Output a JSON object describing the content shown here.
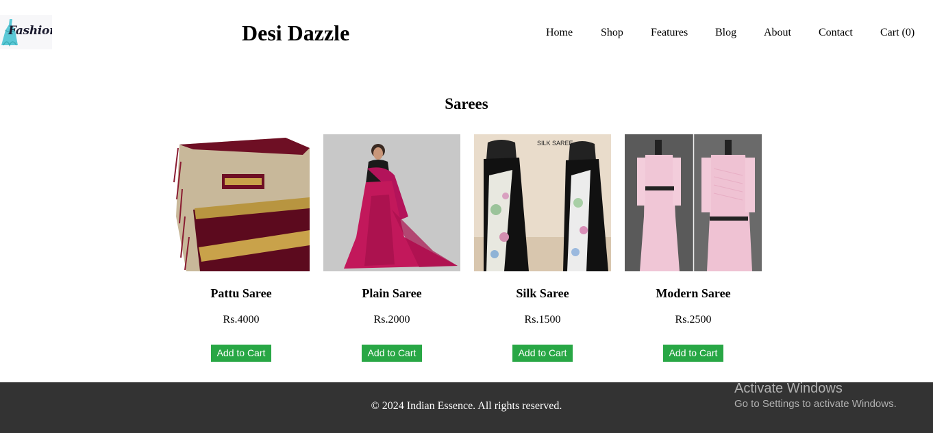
{
  "header": {
    "logo_text": "Fashion",
    "logo_sub": "...",
    "brand": "Desi Dazzle"
  },
  "nav": {
    "items": [
      "Home",
      "Shop",
      "Features",
      "Blog",
      "About",
      "Contact",
      "Cart (0)"
    ]
  },
  "main": {
    "section_title": "Sarees",
    "products": [
      {
        "name": "Pattu Saree",
        "price": "Rs.4000",
        "button": "Add to Cart",
        "image": "saree-photo"
      },
      {
        "name": "Plain Saree",
        "price": "Rs.2000",
        "button": "Add to Cart",
        "image": "saree-photo"
      },
      {
        "name": "Silk Saree",
        "price": "Rs.1500",
        "button": "Add to Cart",
        "image": "saree-photo",
        "image_caption": "SILK SAREE"
      },
      {
        "name": "Modern Saree",
        "price": "Rs.2500",
        "button": "Add to Cart",
        "image": "saree-photo"
      }
    ]
  },
  "footer": {
    "copyright": "© 2024 Indian Essence. All rights reserved."
  },
  "watermark": {
    "title": "Activate Windows",
    "subtitle": "Go to Settings to activate Windows."
  },
  "colors": {
    "accent_button": "#28a745",
    "footer_bg": "#333333"
  }
}
